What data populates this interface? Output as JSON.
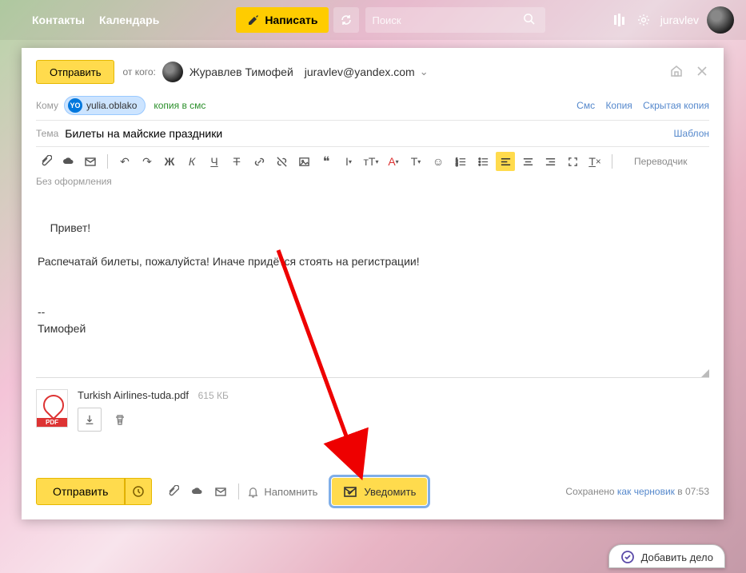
{
  "header": {
    "contacts": "Контакты",
    "calendar": "Календарь",
    "compose": "Написать",
    "search_placeholder": "Поиск",
    "username": "juravlev"
  },
  "compose": {
    "send_top": "Отправить",
    "from_label": "от кого:",
    "from_name": "Журавлев Тимофей",
    "from_email": "juravlev@yandex.com",
    "to_label": "Кому",
    "to_chip_badge": "YO",
    "to_chip": "yulia.oblako",
    "sms_copy": "копия в смс",
    "sms": "Смс",
    "cc": "Копия",
    "bcc": "Скрытая копия",
    "subject_label": "Тема",
    "subject": "Билеты на майские праздники",
    "template": "Шаблон",
    "translator": "Переводчик",
    "no_format": "Без оформления",
    "body": "Привет!\n\nРаспечатай билеты, пожалуйста! Иначе придётся стоять на регистрации!\n\n\n--\nТимофей"
  },
  "attachment": {
    "name": "Turkish Airlines-tuda.pdf",
    "size": "615 КБ",
    "badge": "PDF"
  },
  "footer": {
    "send": "Отправить",
    "remind": "Напомнить",
    "notify": "Уведомить",
    "saved_prefix": "Сохранено ",
    "draft": "как черновик",
    "saved_time": " в 07:53"
  },
  "addtask": "Добавить дело"
}
